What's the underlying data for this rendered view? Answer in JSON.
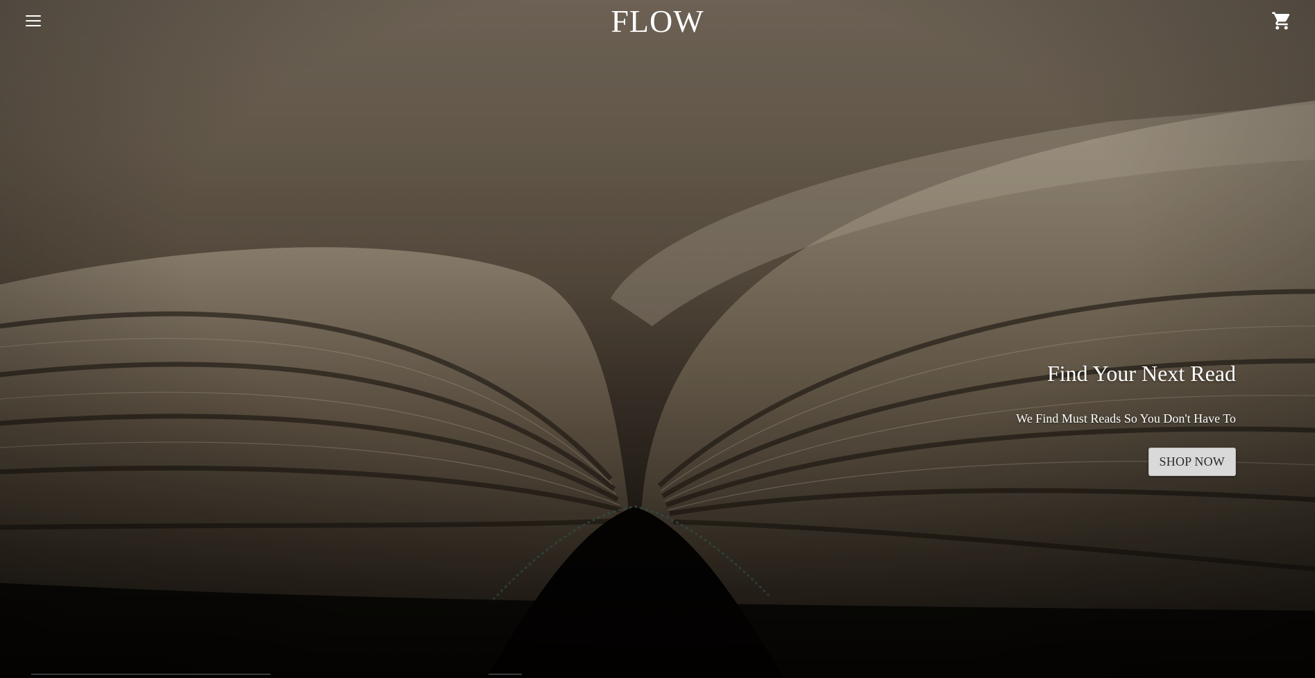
{
  "header": {
    "menu_icon": "hamburger-menu-icon",
    "brand": "FLOW",
    "cart_icon": "shopping-cart-icon"
  },
  "hero": {
    "title": "Find Your Next Read",
    "subtitle": "We Find Must Reads So You Don't Have To",
    "cta_label": "SHOP NOW",
    "background_image": "open-book-photo"
  },
  "colors": {
    "text": "#ffffff",
    "button_bg": "#d9d9d9",
    "button_text": "#2a2a2a",
    "overlay": "#000000"
  }
}
